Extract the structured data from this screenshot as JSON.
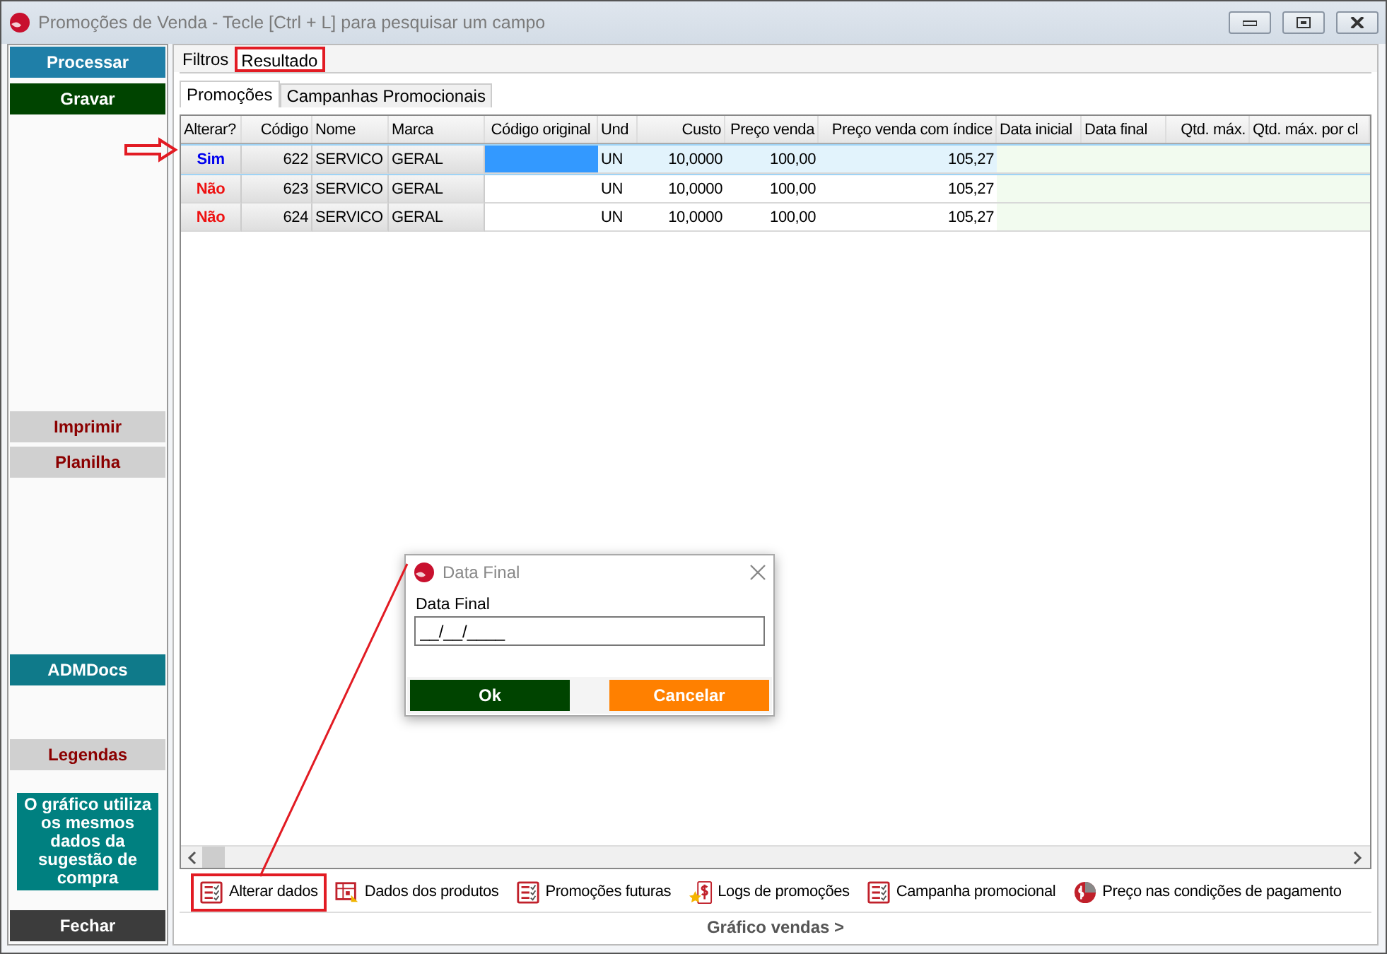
{
  "window": {
    "title": "Promoções de Venda - Tecle [Ctrl + L] para pesquisar um campo"
  },
  "sidebar": {
    "items": [
      {
        "label": "Processar",
        "kind": "button",
        "color": "#1f7fa8"
      },
      {
        "label": "Gravar",
        "kind": "button",
        "color": "#004400"
      },
      {
        "label": "Imprimir",
        "kind": "header"
      },
      {
        "label": "Planilha",
        "kind": "header"
      },
      {
        "label": "ADMDocs",
        "kind": "button",
        "color": "#0f7a8a"
      },
      {
        "label": "Legendas",
        "kind": "header"
      },
      {
        "label": "O gráfico utiliza os mesmos dados da sugestão de compra",
        "kind": "note",
        "color": "#008080"
      },
      {
        "label": "Fechar",
        "kind": "button",
        "color": "#3c3c3c"
      }
    ]
  },
  "tabs": [
    {
      "label": "Filtros",
      "selected": false,
      "highlighted": false
    },
    {
      "label": "Resultado",
      "selected": true,
      "highlighted": true
    }
  ],
  "subtabs": [
    {
      "label": "Promoções",
      "selected": true
    },
    {
      "label": "Campanhas Promocionais",
      "selected": false
    }
  ],
  "table": {
    "columns": [
      "Alterar?",
      "Código",
      "Nome",
      "Marca",
      "Código original",
      "Und",
      "Custo",
      "Preço venda",
      "Preço venda com índice",
      "Data inicial",
      "Data final",
      "Qtd. máx.",
      "Qtd. máx. por cl"
    ],
    "rows": [
      {
        "selected": true,
        "alterar": "Sim",
        "color": "#0000ee",
        "codigo": "622",
        "nome": "SERVICO",
        "marca": "GERAL",
        "focused": true,
        "und": "UN",
        "custo": "10,0000",
        "preco_venda": "100,00",
        "preco_indice": "105,27"
      },
      {
        "selected": false,
        "alterar": "Não",
        "color": "#ee1111",
        "codigo": "623",
        "nome": "SERVICO",
        "marca": "GERAL",
        "focused": false,
        "und": "UN",
        "custo": "10,0000",
        "preco_venda": "100,00",
        "preco_indice": "105,27"
      },
      {
        "selected": false,
        "alterar": "Não",
        "color": "#ee1111",
        "codigo": "624",
        "nome": "SERVICO",
        "marca": "GERAL",
        "focused": false,
        "und": "UN",
        "custo": "10,0000",
        "preco_venda": "100,00",
        "preco_indice": "105,27"
      }
    ]
  },
  "toolbar": [
    {
      "label": "Alterar dados",
      "kind": "list",
      "highlighted": true
    },
    {
      "label": "Dados dos produtos",
      "kind": "grid",
      "highlighted": false
    },
    {
      "label": "Promoções futuras",
      "kind": "list",
      "highlighted": false
    },
    {
      "label": "Logs de promoções",
      "kind": "log",
      "highlighted": false
    },
    {
      "label": "Campanha promocional",
      "kind": "list",
      "highlighted": false
    },
    {
      "label": "Preço nas condições de pagamento",
      "kind": "payment",
      "highlighted": false
    }
  ],
  "footer_link": "Gráfico vendas >",
  "dialog": {
    "title": "Data Final",
    "label": "Data Final",
    "value": "__/__/____",
    "buttons": [
      {
        "label": "Ok",
        "kind": "ok"
      },
      {
        "label": "Cancelar",
        "kind": "cancel"
      }
    ]
  }
}
